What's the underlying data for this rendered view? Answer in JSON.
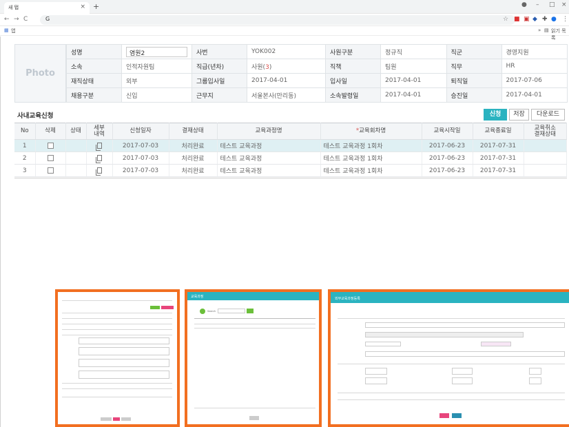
{
  "browser": {
    "tab_title": "새 탭",
    "address": "G",
    "apps_label": "앱",
    "reading_list": "읽기 목록"
  },
  "photo_label": "Photo",
  "employee": {
    "rows": [
      [
        {
          "label": "성명",
          "value": "염원2"
        },
        {
          "label": "사번",
          "value": "YOK002"
        },
        {
          "label": "사원구분",
          "value": "정규직"
        },
        {
          "label": "직군",
          "value": "경영지원"
        }
      ],
      [
        {
          "label": "소속",
          "value": "인적자원팀"
        },
        {
          "label": "직급(년차)",
          "value": "사원(3)"
        },
        {
          "label": "직책",
          "value": "팀원"
        },
        {
          "label": "직무",
          "value": "HR"
        }
      ],
      [
        {
          "label": "재직상태",
          "value": "외부"
        },
        {
          "label": "그룹입사일",
          "value": "2017-04-01"
        },
        {
          "label": "입사일",
          "value": "2017-04-01"
        },
        {
          "label": "퇴직일",
          "value": "2017-07-06"
        }
      ],
      [
        {
          "label": "채용구분",
          "value": "신입"
        },
        {
          "label": "근무지",
          "value": "서울본사(만리동)"
        },
        {
          "label": "소속발령일",
          "value": "2017-04-01"
        },
        {
          "label": "승진일",
          "value": "2017-04-01"
        }
      ]
    ],
    "grade_prefix": "사원(",
    "grade_num": "3",
    "grade_suffix": ")"
  },
  "section": {
    "title": "사내교육신청",
    "apply_label": "신청",
    "save_label": "저장",
    "download_label": "다운로드"
  },
  "grid": {
    "headers": {
      "no": "No",
      "delete": "삭제",
      "status": "상태",
      "detail_1": "세부",
      "detail_2": "내역",
      "apply_date": "신청일자",
      "approval": "결재상태",
      "course": "교육과정명",
      "session_mark": "*",
      "session": "교육회차명",
      "start": "교육시작일",
      "end": "교육종료일",
      "cancel_1": "교육취소",
      "cancel_2": "결재상태"
    },
    "rows": [
      {
        "no": "1",
        "apply_date": "2017-07-03",
        "approval": "처리완료",
        "course": "테스트 교육과정",
        "session": "테스트 교육과정 1회차",
        "start": "2017-06-23",
        "end": "2017-07-31"
      },
      {
        "no": "2",
        "apply_date": "2017-07-03",
        "approval": "처리완료",
        "course": "테스트 교육과정",
        "session": "테스트 교육과정 1회차",
        "start": "2017-06-23",
        "end": "2017-07-31"
      },
      {
        "no": "3",
        "apply_date": "2017-07-03",
        "approval": "처리완료",
        "course": "테스트 교육과정",
        "session": "테스트 교육과정 1회차",
        "start": "2017-06-23",
        "end": "2017-07-31"
      }
    ]
  },
  "thumbnails": {
    "middle_title": "교육과정",
    "middle_search": "Search",
    "right_title": "외부교육과정등록"
  },
  "colors": {
    "accent": "#2bb3c0",
    "highlight": "#f26f21",
    "selected_row": "#dff0f3"
  }
}
